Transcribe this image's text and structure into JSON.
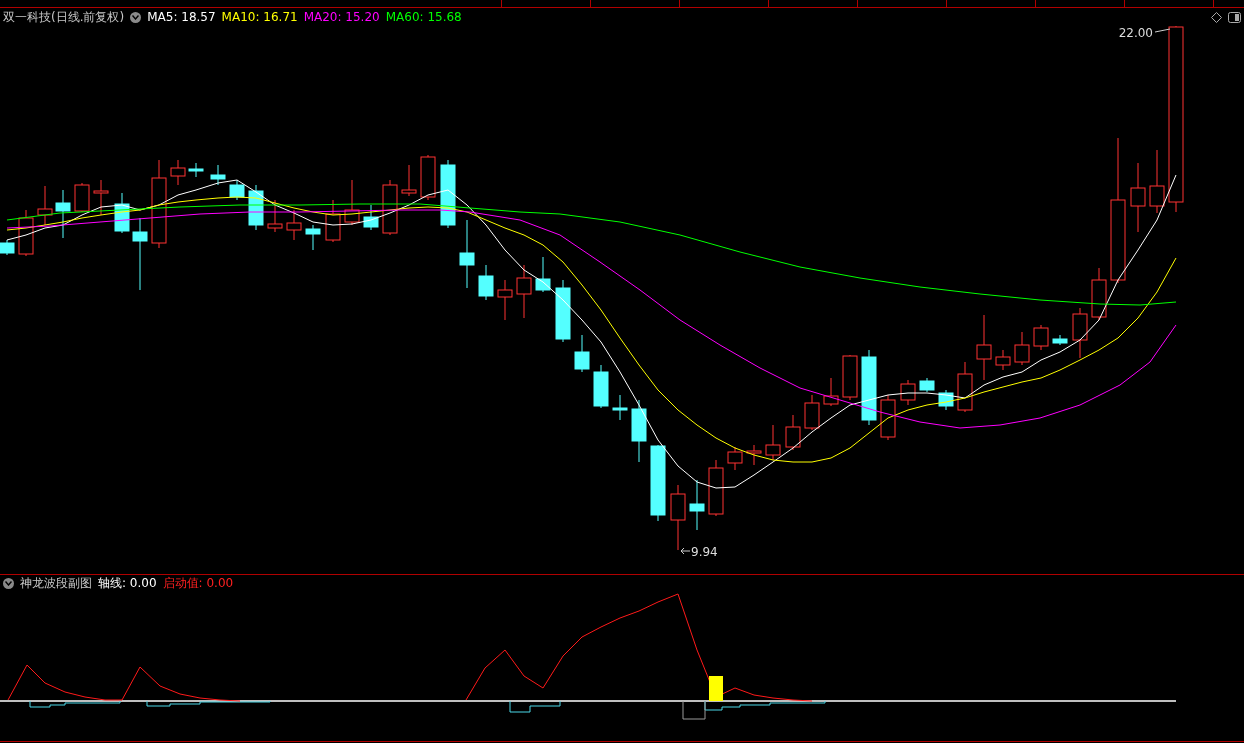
{
  "chart": {
    "title": "双一科技(日线.前复权)",
    "indicators": [
      {
        "label": "MA5: 18.57",
        "color": "#ffffff"
      },
      {
        "label": "MA10: 16.71",
        "color": "#ffff00"
      },
      {
        "label": "MA20: 15.20",
        "color": "#ff00ff"
      },
      {
        "label": "MA60: 15.68",
        "color": "#00ff00"
      }
    ],
    "high_label": "22.00",
    "low_label": "9.94"
  },
  "subchart": {
    "title": "神龙波段副图",
    "axis_label": "轴线: 0.00",
    "start_label": "启动值: 0.00"
  }
}
